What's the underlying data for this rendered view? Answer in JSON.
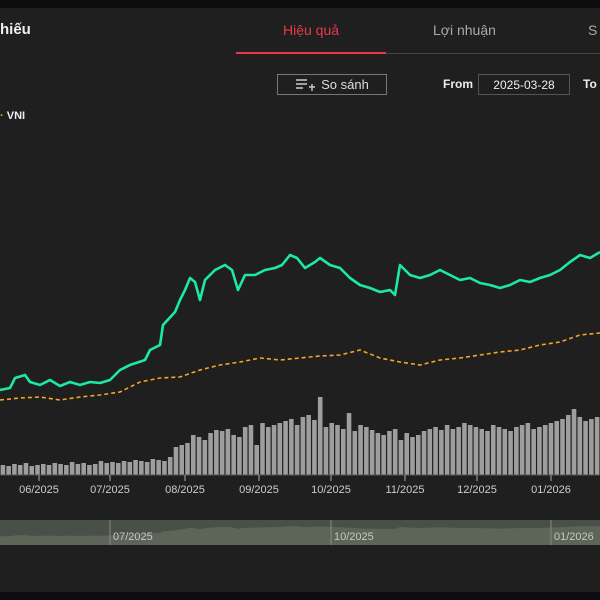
{
  "header": {
    "title": "hiếu"
  },
  "tabs": [
    {
      "label": "Hiệu quả",
      "active": true
    },
    {
      "label": "Lợi nhuận",
      "active": false
    },
    {
      "label": "S",
      "active": false
    }
  ],
  "toolbar": {
    "compare_label": "So sánh",
    "compare_icon": "list-add-icon",
    "from_label": "From",
    "from_value": "2025-03-28",
    "to_label": "To"
  },
  "legend": {
    "series_name": "VNI"
  },
  "colors": {
    "stock": "#1de9a6",
    "vni": "#f5a623",
    "volume": "#9e9e9e",
    "active_tab": "#e8394b",
    "navigator": "#5d6458"
  },
  "chart_data": {
    "type": "line",
    "x_ticks": [
      "06/2025",
      "07/2025",
      "08/2025",
      "09/2025",
      "10/2025",
      "11/2025",
      "12/2025",
      "01/2026"
    ],
    "navigator_ticks": [
      "07/2025",
      "10/2025",
      "01/2026"
    ],
    "grid": false,
    "series": [
      {
        "key": "stock",
        "points": [
          [
            0,
            105
          ],
          [
            10,
            106
          ],
          [
            15,
            111
          ],
          [
            25,
            112.5
          ],
          [
            30,
            109
          ],
          [
            40,
            107.5
          ],
          [
            50,
            110
          ],
          [
            60,
            107
          ],
          [
            70,
            109
          ],
          [
            80,
            107.5
          ],
          [
            90,
            109
          ],
          [
            100,
            108.5
          ],
          [
            110,
            110
          ],
          [
            120,
            115
          ],
          [
            130,
            117.5
          ],
          [
            145,
            120
          ],
          [
            150,
            125
          ],
          [
            160,
            127.5
          ],
          [
            163,
            137.5
          ],
          [
            175,
            144
          ],
          [
            180,
            150
          ],
          [
            185,
            155
          ],
          [
            190,
            161
          ],
          [
            195,
            159
          ],
          [
            200,
            150
          ],
          [
            205,
            160
          ],
          [
            215,
            165
          ],
          [
            225,
            167.5
          ],
          [
            232,
            165
          ],
          [
            238,
            155
          ],
          [
            245,
            162.5
          ],
          [
            255,
            162.5
          ],
          [
            265,
            165
          ],
          [
            275,
            166
          ],
          [
            282,
            167.5
          ],
          [
            290,
            172.5
          ],
          [
            297,
            171
          ],
          [
            305,
            166
          ],
          [
            315,
            169
          ],
          [
            320,
            171
          ],
          [
            330,
            167.5
          ],
          [
            340,
            166
          ],
          [
            350,
            161
          ],
          [
            360,
            157.5
          ],
          [
            370,
            156
          ],
          [
            380,
            154
          ],
          [
            390,
            155
          ],
          [
            395,
            152.5
          ],
          [
            400,
            167.5
          ],
          [
            410,
            162.5
          ],
          [
            420,
            161
          ],
          [
            430,
            162.5
          ],
          [
            440,
            165
          ],
          [
            450,
            162.5
          ],
          [
            460,
            160
          ],
          [
            470,
            161
          ],
          [
            480,
            158.5
          ],
          [
            490,
            157.5
          ],
          [
            500,
            156
          ],
          [
            510,
            157.5
          ],
          [
            520,
            160
          ],
          [
            530,
            159
          ],
          [
            540,
            161
          ],
          [
            550,
            162.5
          ],
          [
            560,
            165
          ],
          [
            570,
            169
          ],
          [
            580,
            172.5
          ],
          [
            590,
            171
          ],
          [
            600,
            174
          ]
        ]
      },
      {
        "key": "vni",
        "name": "VNI",
        "points": [
          [
            0,
            100
          ],
          [
            20,
            101
          ],
          [
            40,
            101.5
          ],
          [
            60,
            100
          ],
          [
            80,
            101.5
          ],
          [
            100,
            102.5
          ],
          [
            120,
            104
          ],
          [
            140,
            109
          ],
          [
            160,
            111
          ],
          [
            180,
            111.5
          ],
          [
            200,
            115
          ],
          [
            220,
            117.5
          ],
          [
            240,
            119
          ],
          [
            260,
            121
          ],
          [
            280,
            120
          ],
          [
            300,
            121
          ],
          [
            320,
            122
          ],
          [
            340,
            122.5
          ],
          [
            360,
            125
          ],
          [
            380,
            121
          ],
          [
            400,
            119
          ],
          [
            420,
            117.5
          ],
          [
            440,
            120
          ],
          [
            460,
            121
          ],
          [
            480,
            122.5
          ],
          [
            500,
            124
          ],
          [
            520,
            125
          ],
          [
            540,
            127.5
          ],
          [
            560,
            129
          ],
          [
            580,
            132.5
          ],
          [
            600,
            133.5
          ]
        ]
      }
    ],
    "volume": [
      10,
      9,
      11,
      10,
      12,
      9,
      10,
      11,
      10,
      12,
      11,
      10,
      13,
      11,
      12,
      10,
      11,
      14,
      12,
      13,
      12,
      14,
      13,
      15,
      14,
      13,
      16,
      15,
      14,
      18,
      28,
      30,
      32,
      40,
      38,
      35,
      42,
      45,
      44,
      46,
      40,
      38,
      48,
      50,
      30,
      52,
      48,
      50,
      52,
      54,
      56,
      50,
      58,
      60,
      55,
      78,
      48,
      52,
      50,
      46,
      62,
      44,
      50,
      48,
      45,
      42,
      40,
      44,
      46,
      35,
      42,
      38,
      40,
      44,
      46,
      48,
      45,
      50,
      46,
      48,
      52,
      50,
      48,
      46,
      44,
      50,
      48,
      46,
      44,
      48,
      50,
      52,
      46,
      48,
      50,
      52,
      54,
      56,
      60,
      66,
      58,
      54,
      56,
      58
    ]
  }
}
